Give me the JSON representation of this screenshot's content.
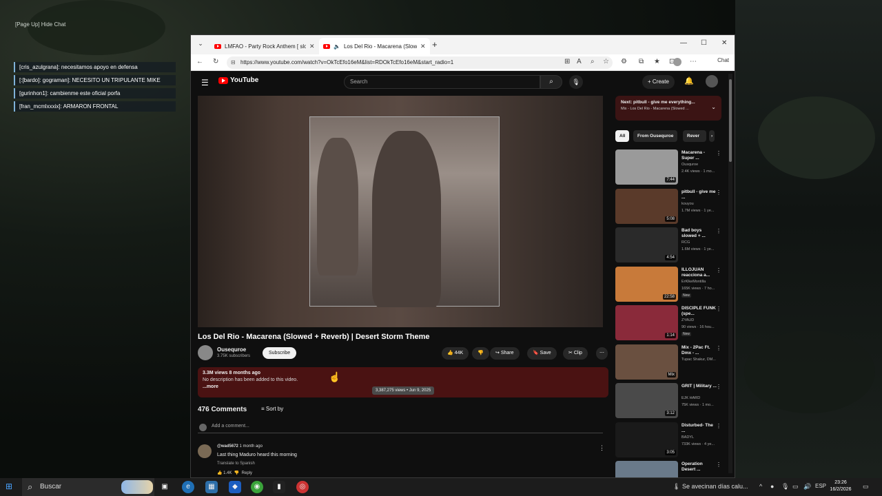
{
  "overlay": {
    "hide_chat": "[Page Up] Hide Chat",
    "chat": [
      "[cris_azulgrana]: necesitamos apoyo en defensa",
      "[:[bardo]: gograman]: NECESITO UN TRIPULANTE MIKE",
      "[gurinhon1]: cambienme este oficial porfa",
      "[fran_mcmlxxxix]: ARMARON FRONTAL"
    ]
  },
  "browser": {
    "tabs": [
      {
        "title": "LMFAO - Party Rock Anthem [ slow"
      },
      {
        "title": "Los Del Rio - Macarena (Slowe"
      }
    ],
    "url": "https://www.youtube.com/watch?v=OkTcEfo16eM&list=RDOkTcEfo16eM&start_radio=1",
    "chat_label": "Chat"
  },
  "youtube": {
    "logo": "YouTube",
    "search_placeholder": "Search",
    "create_label": "Create",
    "video": {
      "title": "Los Del Rio - Macarena (Slowed + Reverb) | Desert Storm Theme",
      "channel": "Ousequroe",
      "subscribers": "3.75K subscribers",
      "subscribe_label": "Subscribe",
      "likes": "44K",
      "share_label": "Share",
      "save_label": "Save",
      "clip_label": "Clip",
      "views_line": "3.3M views  8 months ago",
      "description": "No description has been added to this video.",
      "more_label": "...more",
      "tooltip": "3,387,275 views • Jun 9, 2025"
    },
    "comments": {
      "count": "476 Comments",
      "sort_label": "Sort by",
      "add_placeholder": "Add a comment...",
      "items": [
        {
          "user": "@wad5672",
          "time": "1 month ago",
          "text": "Last thing Maduro heard this morning",
          "translate": "Translate to Spanish",
          "likes": "1.4K",
          "reply": "Reply"
        }
      ]
    },
    "up_next": {
      "title": "Next: pitbull - give me everything...",
      "subtitle": "Mix - Los Del Rio - Macarena (Slowed ..."
    },
    "chips": [
      "All",
      "From Ousequroe",
      "Rever"
    ],
    "recs": [
      {
        "title": "Macarena - Super ...",
        "channel": "Ousquroe",
        "meta": "2.4K views · 1 mo...",
        "duration": "7:44",
        "thumb": "#9a9a9a"
      },
      {
        "title": "pitbull - give me ...",
        "channel": "kouyou",
        "meta": "1.7M views · 1 ye...",
        "duration": "5:08",
        "thumb": "#5a3a2a"
      },
      {
        "title": "Bad boys slowed + ...",
        "channel": "RCG",
        "meta": "1.6M views · 1 ye...",
        "duration": "4:54",
        "thumb": "#2a2a2a"
      },
      {
        "title": "ILLOJUAN reacciona a...",
        "channel": "ErKlkeMontilla",
        "meta": "165K views · 7 ho...",
        "duration": "22:58",
        "thumb": "#c87a3a",
        "badge": "New"
      },
      {
        "title": "DISCIPLE FUNK (spe...",
        "channel": "ZYAUD",
        "meta": "90 views · 16 hou...",
        "duration": "1:14",
        "thumb": "#8a2a3a",
        "badge": "New"
      },
      {
        "title": "Mix - 2Pac Ft. Dmx - ...",
        "channel": "Tupac Shakur, DM...",
        "meta": "",
        "duration": "Mix",
        "thumb": "#6a5040"
      },
      {
        "title": "GRIT | Military ...",
        "channel": "EJK HARD",
        "meta": "75K views · 1 mo...",
        "duration": "3:12",
        "thumb": "#4a4a4a"
      },
      {
        "title": "Disturbed- The ...",
        "channel": "BADYL",
        "meta": "733K views · 4 ye...",
        "duration": "3:05",
        "thumb": "#1a1a1a"
      },
      {
        "title": "Operation Desert ...",
        "channel": "",
        "meta": "",
        "duration": "",
        "thumb": "#6a7a8a"
      }
    ]
  },
  "taskbar": {
    "search": "Buscar",
    "news": "Se avecinan días calu...",
    "lang": "ESP",
    "time": "23:26",
    "date": "16/2/2026"
  },
  "colors": {
    "youtube_red": "#ff0000",
    "desc_bg": "#4a1212",
    "upnext_bg": "#3b1414"
  }
}
